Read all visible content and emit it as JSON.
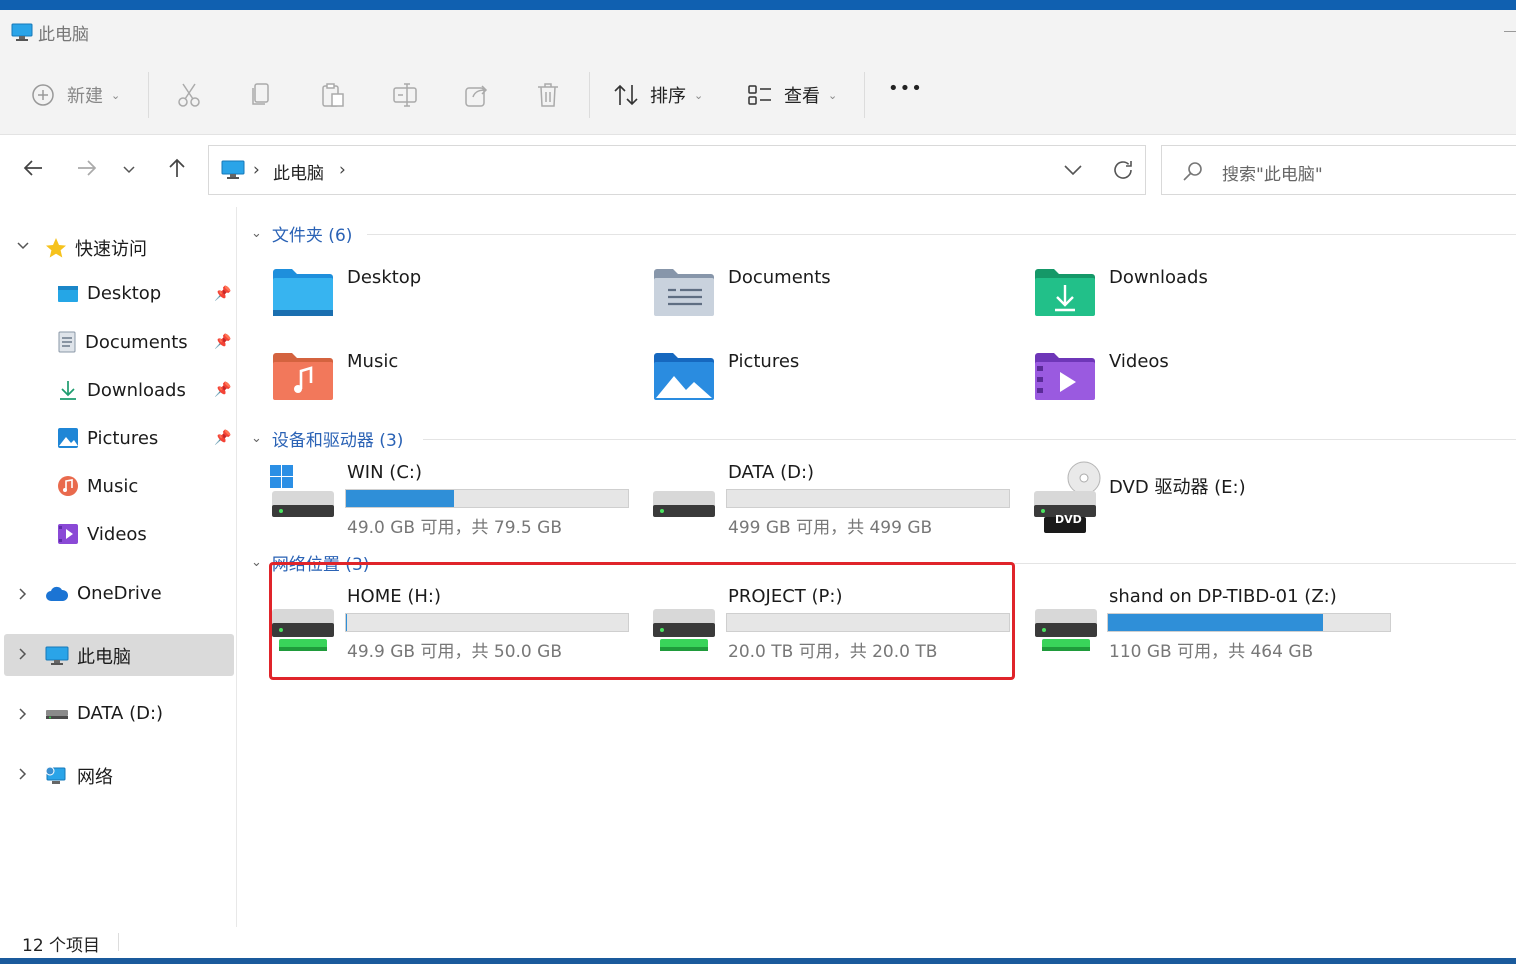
{
  "window": {
    "title": "此电脑"
  },
  "toolbar": {
    "new_label": "新建",
    "sort_label": "排序",
    "view_label": "查看",
    "more_label": "•••"
  },
  "nav": {
    "breadcrumb": "此电脑",
    "search_placeholder": "搜索\"此电脑\""
  },
  "sidebar": {
    "quick_access": "快速访问",
    "pinned": [
      {
        "label": "Desktop"
      },
      {
        "label": "Documents"
      },
      {
        "label": "Downloads"
      },
      {
        "label": "Pictures"
      },
      {
        "label": "Music"
      },
      {
        "label": "Videos"
      }
    ],
    "roots": [
      {
        "label": "OneDrive"
      },
      {
        "label": "此电脑"
      },
      {
        "label": "DATA (D:)"
      },
      {
        "label": "网络"
      }
    ]
  },
  "groups": {
    "folders": {
      "title": "文件夹 (6)",
      "items": [
        {
          "name": "Desktop"
        },
        {
          "name": "Documents"
        },
        {
          "name": "Downloads"
        },
        {
          "name": "Music"
        },
        {
          "name": "Pictures"
        },
        {
          "name": "Videos"
        }
      ]
    },
    "devices": {
      "title": "设备和驱动器 (3)",
      "items": [
        {
          "name": "WIN (C:)",
          "usage": "49.0 GB 可用，共 79.5 GB",
          "used_fraction": 0.384
        },
        {
          "name": "DATA (D:)",
          "usage": "499 GB 可用，共 499 GB",
          "used_fraction": 0.0
        },
        {
          "name": "DVD 驱动器 (E:)",
          "badge": "DVD"
        }
      ]
    },
    "network": {
      "title": "网络位置 (3)",
      "items": [
        {
          "name": "HOME (H:)",
          "usage": "49.9 GB 可用，共 50.0 GB",
          "used_fraction": 0.002
        },
        {
          "name": "PROJECT (P:)",
          "usage": "20.0 TB 可用，共 20.0 TB",
          "used_fraction": 0.0
        },
        {
          "name": "shand on DP-TIBD-01 (Z:)",
          "usage": "110 GB 可用，共 464 GB",
          "used_fraction": 0.763
        }
      ]
    }
  },
  "status": {
    "item_count": "12 个项目"
  },
  "colors": {
    "accent": "#2f8fd8",
    "highlight": "#e0242a",
    "group_title": "#2a62b5"
  }
}
